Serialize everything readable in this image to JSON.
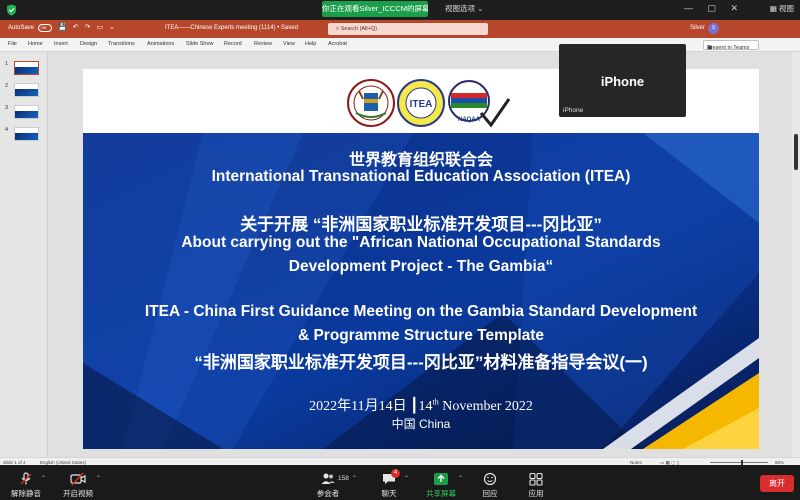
{
  "zoom": {
    "share_banner": "你正在观看Silver_ICCCM的屏幕",
    "view_options": "视图选项",
    "view_button": "视图",
    "iphone_name": "iPhone",
    "iphone_tag": "iPhone",
    "toolbar": {
      "mute": "解除静音",
      "video": "开启视频",
      "participants": "参会者",
      "participants_count": "158",
      "chat": "聊天",
      "chat_badge": "4",
      "share": "共享屏幕",
      "reactions": "回应",
      "apps": "应用",
      "leave": "离开"
    },
    "colors": {
      "share_green": "#1a9e4a",
      "leave_red": "#d92c2c",
      "ppt_red": "#b7472a"
    }
  },
  "ppt": {
    "autosave": "AutoSave",
    "autosave_state": "Off",
    "doc_title": "ITEA——Chinese Experts meeting (1114) • Saved",
    "search_placeholder": "Search (Alt+Q)",
    "user_name": "Silver",
    "user_initial": "S",
    "ribbon_tabs": [
      "File",
      "Home",
      "Insert",
      "Design",
      "Transitions",
      "Animations",
      "Slide Show",
      "Record",
      "Review",
      "View",
      "Help",
      "Acrobat"
    ],
    "present_teams": "Present in Teams",
    "slide_numbers": [
      "1",
      "2",
      "3",
      "4"
    ],
    "status": {
      "slide_of": "Slide 1 of 4",
      "language": "English (United States)",
      "notes": "Notes",
      "zoom": "85%"
    }
  },
  "slide": {
    "cn_org": "世界教育组织联合会",
    "en_org": "International Transnational Education Association (ITEA)",
    "cn_project": "关于开展 “非洲国家职业标准开发项目---冈比亚”",
    "en_project_1": "About carrying out the \"African National Occupational Standards",
    "en_project_2": "Development Project - The Gambia“",
    "en_meeting_1": "ITEA - China First Guidance Meeting on the Gambia Standard Development",
    "en_meeting_2": "& Programme Structure Template",
    "cn_meeting": "“非洲国家职业标准开发项目---冈比亚”材料准备指导会议(一)",
    "date_cn": "2022年11月14日",
    "date_day": "14",
    "date_suffix": "th",
    "date_rest": "November 2022",
    "location": "中国 China",
    "logo_itea": "ITEA",
    "logo_naqaa": "NAQAA"
  }
}
